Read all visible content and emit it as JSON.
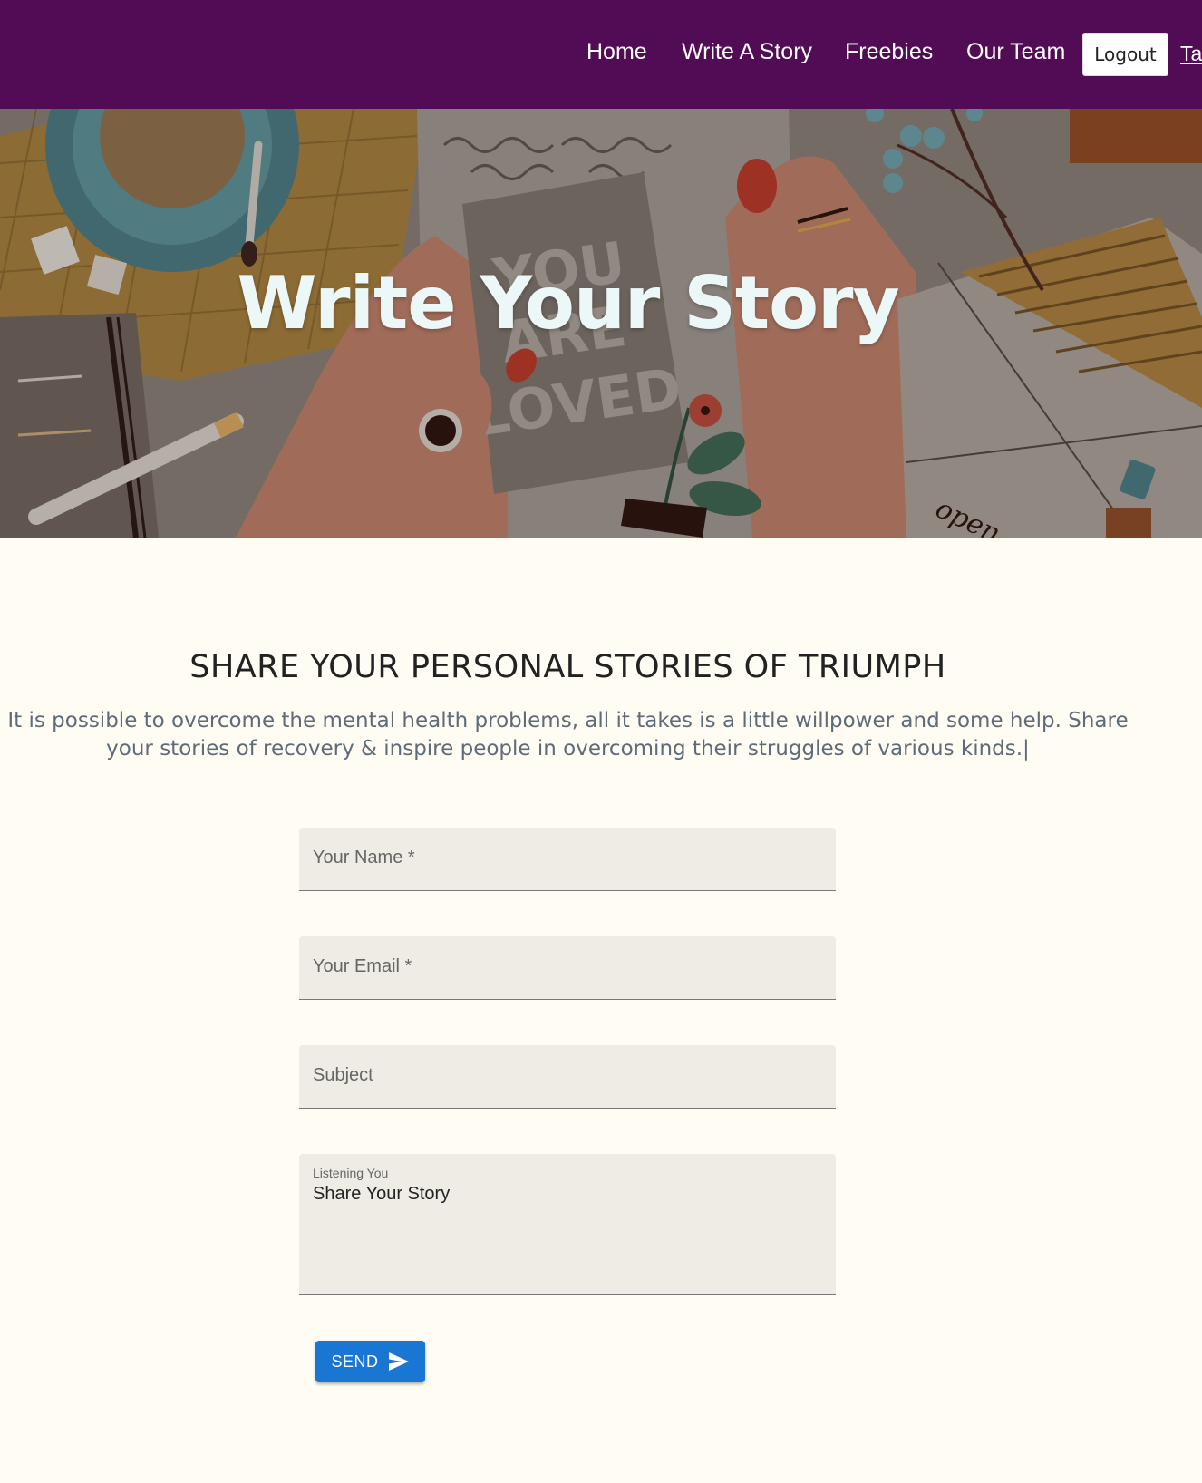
{
  "nav": {
    "links": [
      "Home",
      "Write A Story",
      "Freebies",
      "Our Team"
    ],
    "logout_label": "Logout",
    "extra_label": "Ta"
  },
  "hero": {
    "title": "Write Your Story",
    "card_text": [
      "YOU",
      "ARE",
      "LOVED"
    ],
    "envelope_text": "open"
  },
  "section": {
    "heading": "SHARE YOUR PERSONAL STORIES OF TRIUMPH",
    "description": "It is possible to overcome the mental health problems, all it takes is a little willpower and some help. Share your stories of recovery & inspire people in overcoming their struggles of various kinds.|"
  },
  "form": {
    "name_placeholder": "Your Name *",
    "email_placeholder": "Your Email *",
    "subject_placeholder": "Subject",
    "message_label": "Listening You",
    "message_value": "Share Your Story",
    "send_label": "SEND",
    "send_icon": "send-arrow-icon"
  },
  "colors": {
    "navbar": "#520c55",
    "page_background": "#fffcf4",
    "send_button": "#1976d2",
    "field_background": "#efece5"
  }
}
